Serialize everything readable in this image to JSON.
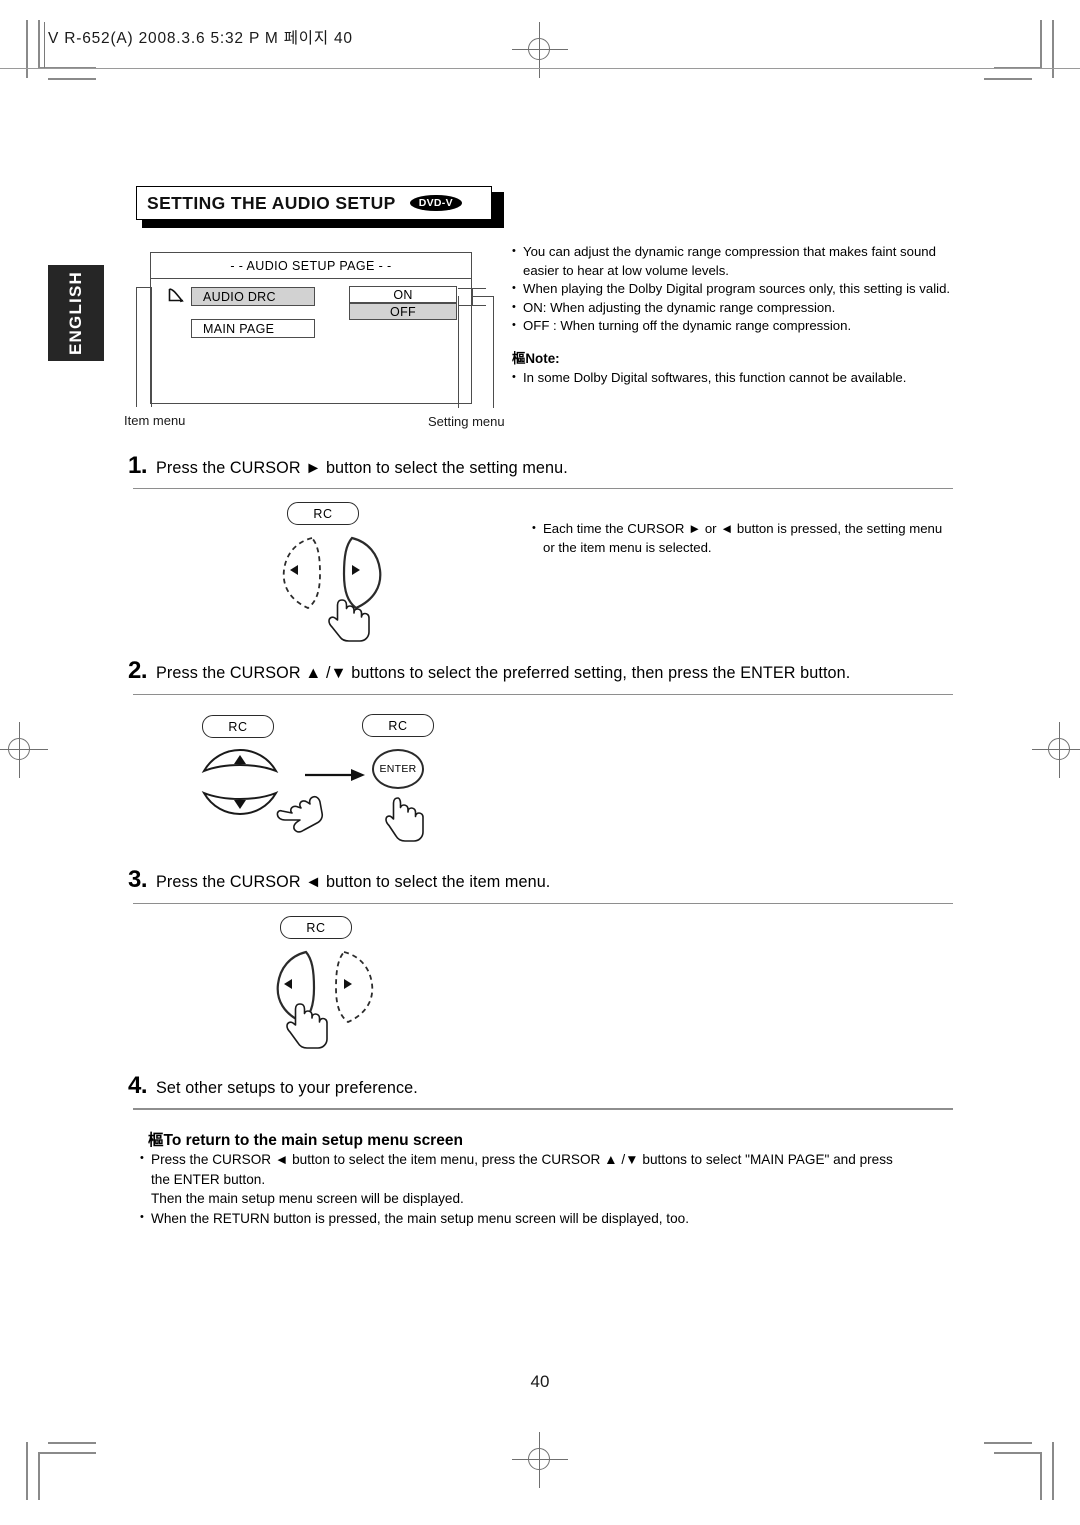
{
  "print_header": "V R-652(A)  2008.3.6  5:32 P M 페이지 40",
  "side_tab": {
    "label": "ENGLISH"
  },
  "title": {
    "heading": "SETTING THE AUDIO SETUP",
    "badge": "DVD-V"
  },
  "osd_menu": {
    "title": "- - AUDIO SETUP PAGE - -",
    "item_menu_label": "Item menu",
    "setting_menu_label": "Setting menu",
    "items": [
      {
        "label": "AUDIO DRC",
        "selected": true
      },
      {
        "label": "MAIN PAGE",
        "selected": false
      }
    ],
    "settings": [
      {
        "label": "ON",
        "selected": false
      },
      {
        "label": "OFF",
        "selected": true
      }
    ]
  },
  "description_bullets": [
    "You can adjust the dynamic range compression that makes faint sound easier to hear at low volume levels.",
    "When playing the Dolby Digital program sources only, this setting is valid.",
    "ON: When adjusting the dynamic range compression.",
    "OFF : When turning off the dynamic range compression."
  ],
  "note": {
    "heading": "樞Note:",
    "bullets": [
      "In some Dolby Digital softwares, this function cannot be available."
    ]
  },
  "steps": [
    {
      "num": "1.",
      "text": "Press the CURSOR ►  button to select the setting menu."
    },
    {
      "num": "2.",
      "text": "Press the CURSOR ▲ /▼  buttons to select the preferred setting, then press the ENTER button."
    },
    {
      "num": "3.",
      "text": "Press the CURSOR ◄  button to select the item menu."
    },
    {
      "num": "4.",
      "text": "Set other setups to your preference."
    }
  ],
  "step1_note": "Each time the CURSOR ►  or ◄  button is pressed, the setting menu or the item menu is selected.",
  "remote_labels": {
    "rc": "RC",
    "enter": "ENTER"
  },
  "footer": {
    "heading": "樞To return to the main setup menu screen",
    "bullet1_line1": "Press the CURSOR ◄  button to select the item menu, press the CURSOR ▲ /▼  buttons to select \"MAIN PAGE\" and press",
    "bullet1_line2": "the ENTER button.",
    "bullet1_line3": "Then the main setup menu screen will be displayed.",
    "bullet2": "When the RETURN button is pressed, the main setup menu screen will be displayed, too."
  },
  "page_number": "40"
}
